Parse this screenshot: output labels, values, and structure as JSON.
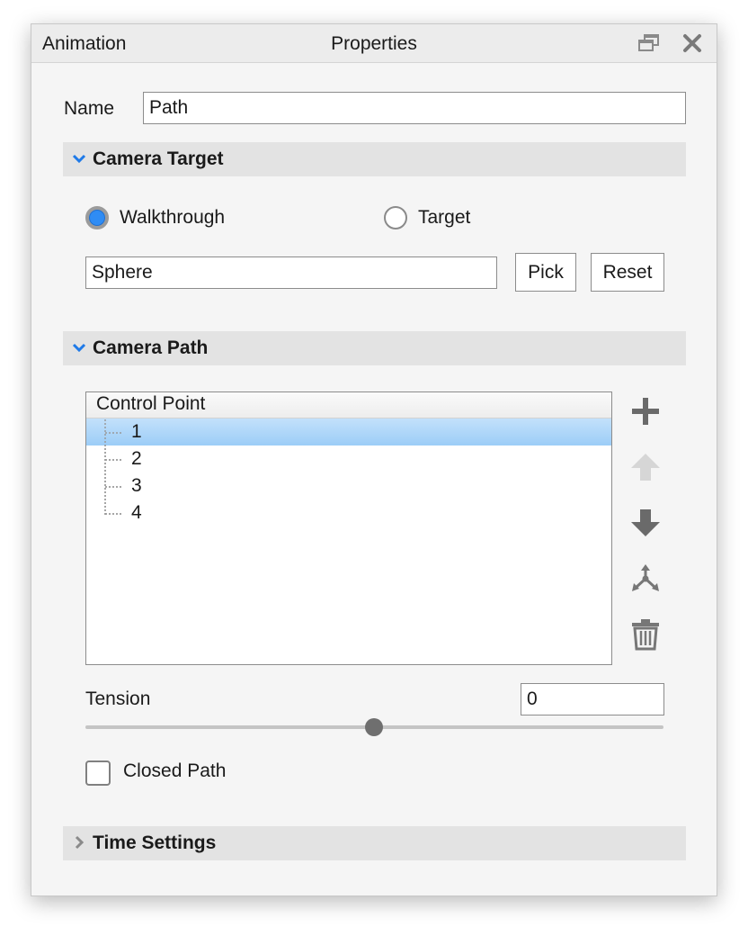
{
  "window": {
    "tab_label": "Animation",
    "title": "Properties"
  },
  "name_field": {
    "label": "Name",
    "value": "Path"
  },
  "camera_target": {
    "section_title": "Camera Target",
    "expanded": true,
    "options": [
      {
        "label": "Walkthrough",
        "selected": true
      },
      {
        "label": "Target",
        "selected": false
      }
    ],
    "target_value": "Sphere",
    "pick_label": "Pick",
    "reset_label": "Reset"
  },
  "camera_path": {
    "section_title": "Camera Path",
    "expanded": true,
    "tree_header": "Control Point",
    "points": [
      "1",
      "2",
      "3",
      "4"
    ],
    "selected_point": "1",
    "side_icons": [
      "add-icon",
      "move-up-icon",
      "move-down-icon",
      "axis-gizmo-icon",
      "trash-icon"
    ],
    "tension_label": "Tension",
    "tension_value": "0",
    "tension_slider_fraction": 0.5,
    "closed_path_label": "Closed Path",
    "closed_path_checked": false
  },
  "time_settings": {
    "section_title": "Time Settings",
    "expanded": false
  },
  "colors": {
    "accent": "#2f8cf4",
    "selection": "#a6d2f8",
    "section_bg": "#e3e3e3",
    "panel_bg": "#f5f5f5"
  }
}
